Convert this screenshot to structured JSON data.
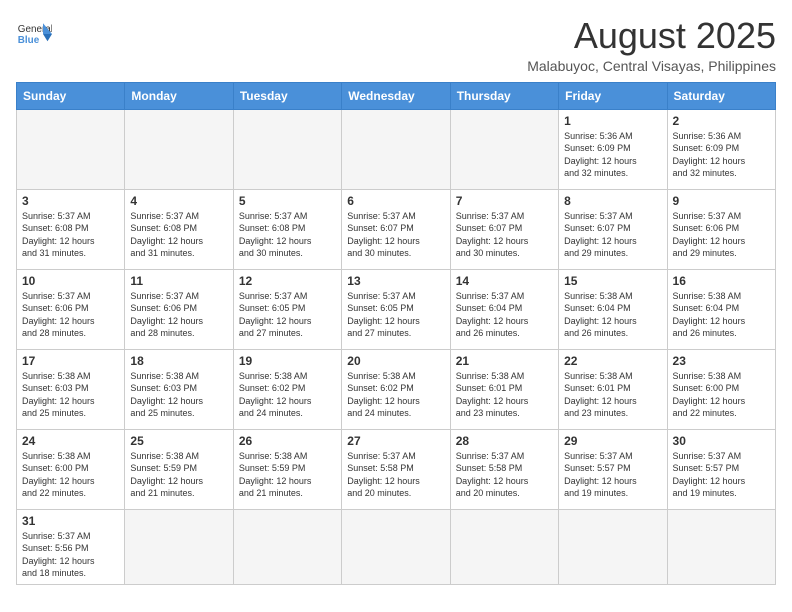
{
  "header": {
    "logo_general": "General",
    "logo_blue": "Blue",
    "month_year": "August 2025",
    "location": "Malabuyoc, Central Visayas, Philippines"
  },
  "days_of_week": [
    "Sunday",
    "Monday",
    "Tuesday",
    "Wednesday",
    "Thursday",
    "Friday",
    "Saturday"
  ],
  "weeks": [
    [
      {
        "day": "",
        "info": ""
      },
      {
        "day": "",
        "info": ""
      },
      {
        "day": "",
        "info": ""
      },
      {
        "day": "",
        "info": ""
      },
      {
        "day": "",
        "info": ""
      },
      {
        "day": "1",
        "info": "Sunrise: 5:36 AM\nSunset: 6:09 PM\nDaylight: 12 hours\nand 32 minutes."
      },
      {
        "day": "2",
        "info": "Sunrise: 5:36 AM\nSunset: 6:09 PM\nDaylight: 12 hours\nand 32 minutes."
      }
    ],
    [
      {
        "day": "3",
        "info": "Sunrise: 5:37 AM\nSunset: 6:08 PM\nDaylight: 12 hours\nand 31 minutes."
      },
      {
        "day": "4",
        "info": "Sunrise: 5:37 AM\nSunset: 6:08 PM\nDaylight: 12 hours\nand 31 minutes."
      },
      {
        "day": "5",
        "info": "Sunrise: 5:37 AM\nSunset: 6:08 PM\nDaylight: 12 hours\nand 30 minutes."
      },
      {
        "day": "6",
        "info": "Sunrise: 5:37 AM\nSunset: 6:07 PM\nDaylight: 12 hours\nand 30 minutes."
      },
      {
        "day": "7",
        "info": "Sunrise: 5:37 AM\nSunset: 6:07 PM\nDaylight: 12 hours\nand 30 minutes."
      },
      {
        "day": "8",
        "info": "Sunrise: 5:37 AM\nSunset: 6:07 PM\nDaylight: 12 hours\nand 29 minutes."
      },
      {
        "day": "9",
        "info": "Sunrise: 5:37 AM\nSunset: 6:06 PM\nDaylight: 12 hours\nand 29 minutes."
      }
    ],
    [
      {
        "day": "10",
        "info": "Sunrise: 5:37 AM\nSunset: 6:06 PM\nDaylight: 12 hours\nand 28 minutes."
      },
      {
        "day": "11",
        "info": "Sunrise: 5:37 AM\nSunset: 6:06 PM\nDaylight: 12 hours\nand 28 minutes."
      },
      {
        "day": "12",
        "info": "Sunrise: 5:37 AM\nSunset: 6:05 PM\nDaylight: 12 hours\nand 27 minutes."
      },
      {
        "day": "13",
        "info": "Sunrise: 5:37 AM\nSunset: 6:05 PM\nDaylight: 12 hours\nand 27 minutes."
      },
      {
        "day": "14",
        "info": "Sunrise: 5:37 AM\nSunset: 6:04 PM\nDaylight: 12 hours\nand 26 minutes."
      },
      {
        "day": "15",
        "info": "Sunrise: 5:38 AM\nSunset: 6:04 PM\nDaylight: 12 hours\nand 26 minutes."
      },
      {
        "day": "16",
        "info": "Sunrise: 5:38 AM\nSunset: 6:04 PM\nDaylight: 12 hours\nand 26 minutes."
      }
    ],
    [
      {
        "day": "17",
        "info": "Sunrise: 5:38 AM\nSunset: 6:03 PM\nDaylight: 12 hours\nand 25 minutes."
      },
      {
        "day": "18",
        "info": "Sunrise: 5:38 AM\nSunset: 6:03 PM\nDaylight: 12 hours\nand 25 minutes."
      },
      {
        "day": "19",
        "info": "Sunrise: 5:38 AM\nSunset: 6:02 PM\nDaylight: 12 hours\nand 24 minutes."
      },
      {
        "day": "20",
        "info": "Sunrise: 5:38 AM\nSunset: 6:02 PM\nDaylight: 12 hours\nand 24 minutes."
      },
      {
        "day": "21",
        "info": "Sunrise: 5:38 AM\nSunset: 6:01 PM\nDaylight: 12 hours\nand 23 minutes."
      },
      {
        "day": "22",
        "info": "Sunrise: 5:38 AM\nSunset: 6:01 PM\nDaylight: 12 hours\nand 23 minutes."
      },
      {
        "day": "23",
        "info": "Sunrise: 5:38 AM\nSunset: 6:00 PM\nDaylight: 12 hours\nand 22 minutes."
      }
    ],
    [
      {
        "day": "24",
        "info": "Sunrise: 5:38 AM\nSunset: 6:00 PM\nDaylight: 12 hours\nand 22 minutes."
      },
      {
        "day": "25",
        "info": "Sunrise: 5:38 AM\nSunset: 5:59 PM\nDaylight: 12 hours\nand 21 minutes."
      },
      {
        "day": "26",
        "info": "Sunrise: 5:38 AM\nSunset: 5:59 PM\nDaylight: 12 hours\nand 21 minutes."
      },
      {
        "day": "27",
        "info": "Sunrise: 5:37 AM\nSunset: 5:58 PM\nDaylight: 12 hours\nand 20 minutes."
      },
      {
        "day": "28",
        "info": "Sunrise: 5:37 AM\nSunset: 5:58 PM\nDaylight: 12 hours\nand 20 minutes."
      },
      {
        "day": "29",
        "info": "Sunrise: 5:37 AM\nSunset: 5:57 PM\nDaylight: 12 hours\nand 19 minutes."
      },
      {
        "day": "30",
        "info": "Sunrise: 5:37 AM\nSunset: 5:57 PM\nDaylight: 12 hours\nand 19 minutes."
      }
    ],
    [
      {
        "day": "31",
        "info": "Sunrise: 5:37 AM\nSunset: 5:56 PM\nDaylight: 12 hours\nand 18 minutes."
      },
      {
        "day": "",
        "info": ""
      },
      {
        "day": "",
        "info": ""
      },
      {
        "day": "",
        "info": ""
      },
      {
        "day": "",
        "info": ""
      },
      {
        "day": "",
        "info": ""
      },
      {
        "day": "",
        "info": ""
      }
    ]
  ]
}
